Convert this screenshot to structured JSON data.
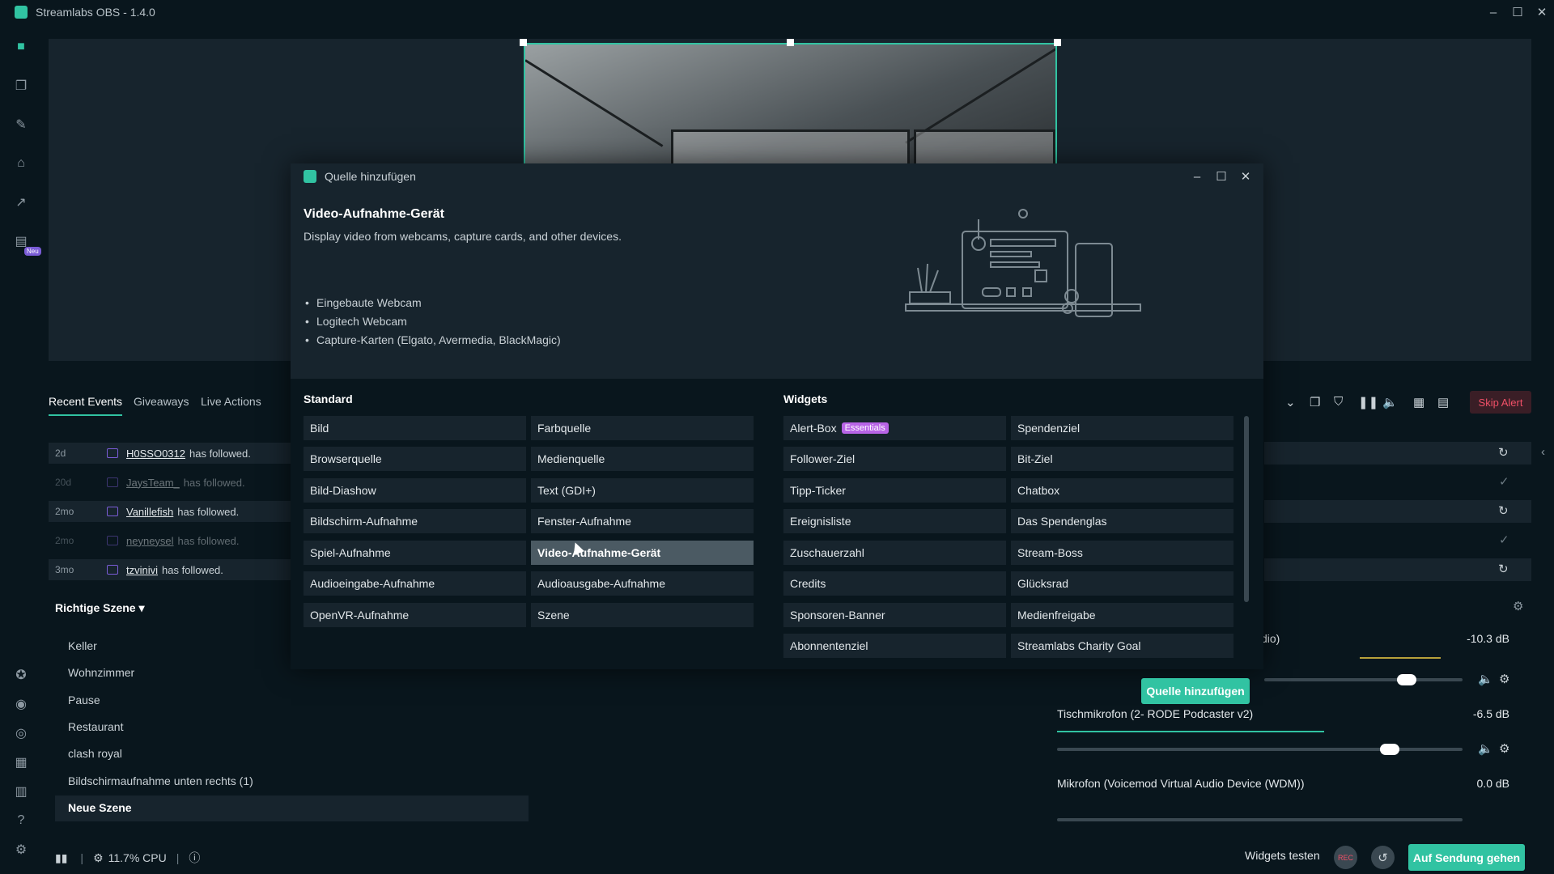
{
  "app": {
    "title": "Streamlabs OBS - 1.4.0",
    "window_controls": [
      "–",
      "☐",
      "✕"
    ]
  },
  "events": {
    "tabs": [
      "Recent Events",
      "Giveaways",
      "Live Actions"
    ],
    "rows": [
      {
        "age": "2d",
        "name": "H0SSO0312",
        "action": "has followed."
      },
      {
        "age": "20d",
        "name": "JaysTeam_",
        "action": "has followed."
      },
      {
        "age": "2mo",
        "name": "Vanillefish",
        "action": "has followed."
      },
      {
        "age": "2mo",
        "name": "neyneysel",
        "action": "has followed."
      },
      {
        "age": "3mo",
        "name": "tzvinivi",
        "action": "has followed."
      }
    ],
    "skip_alert": "Skip Alert"
  },
  "scenes": {
    "title": "Richtige Szene",
    "items": [
      "Keller",
      "Wohnzimmer",
      "Pause",
      "Restaurant",
      "clash royal",
      "Bildschirmaufnahme unten rechts (1)",
      "Neue Szene"
    ],
    "selected": "Neue Szene"
  },
  "mixer": {
    "channels": [
      {
        "label": "dio)",
        "db": "-10.3 dB",
        "level": 0.72
      },
      {
        "label": "Tischmikrofon (2- RODE Podcaster v2)",
        "db": "-6.5 dB",
        "level": 0.82
      },
      {
        "label": "Mikrofon (Voicemod Virtual Audio Device (WDM))",
        "db": "0.0 dB",
        "level": 0.98
      }
    ]
  },
  "statusbar": {
    "cpu": "11.7% CPU",
    "widgets_test": "Widgets testen",
    "rec": "REC",
    "go_live": "Auf Sendung gehen"
  },
  "dialog": {
    "title": "Quelle hinzufügen",
    "source_title": "Video-Aufnahme-Gerät",
    "source_desc": "Display video from webcams, capture cards, and other devices.",
    "bullets": [
      "Eingebaute Webcam",
      "Logitech Webcam",
      "Capture-Karten (Elgato, Avermedia, BlackMagic)"
    ],
    "standard_title": "Standard",
    "widgets_title": "Widgets",
    "standard_col1": [
      "Bild",
      "Browserquelle",
      "Bild-Diashow",
      "Bildschirm-Aufnahme",
      "Spiel-Aufnahme",
      "Audioeingabe-Aufnahme",
      "OpenVR-Aufnahme"
    ],
    "standard_col2": [
      "Farbquelle",
      "Medienquelle",
      "Text (GDI+)",
      "Fenster-Aufnahme",
      "Video-Aufnahme-Gerät",
      "Audioausgabe-Aufnahme",
      "Szene"
    ],
    "widgets_col1": [
      "Alert-Box",
      "Follower-Ziel",
      "Tipp-Ticker",
      "Ereignisliste",
      "Zuschauerzahl",
      "Credits",
      "Sponsoren-Banner",
      "Abonnentenziel"
    ],
    "widgets_col2": [
      "Spendenziel",
      "Bit-Ziel",
      "Chatbox",
      "Das Spendenglas",
      "Stream-Boss",
      "Glücksrad",
      "Medienfreigabe",
      "Streamlabs Charity Goal"
    ],
    "essentials_badge": "Essentials",
    "selected": "Video-Aufnahme-Gerät",
    "add_button": "Quelle hinzufügen"
  },
  "colors": {
    "accent": "#31c3a2",
    "background": "#09161d",
    "panel": "#17242d",
    "danger": "#f05067",
    "badge": "#b864e6"
  }
}
